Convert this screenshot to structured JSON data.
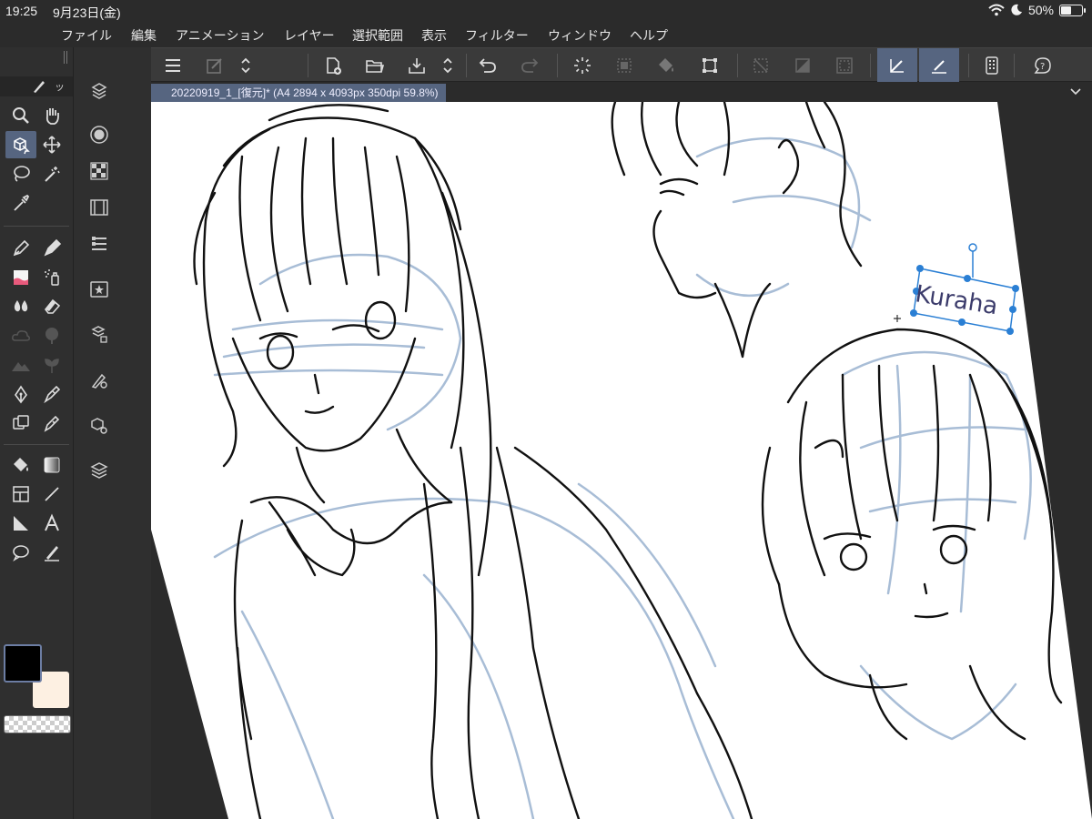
{
  "status": {
    "time": "19:25",
    "date": "9月23日(金)",
    "battery": "50%"
  },
  "menu": [
    "ファイル",
    "編集",
    "アニメーション",
    "レイヤー",
    "選択範囲",
    "表示",
    "フィルター",
    "ウィンドウ",
    "ヘルプ"
  ],
  "document": {
    "tab_title": "20220919_1_[復元]* (A4 2894 x 4093px 350dpi 59.8%)"
  },
  "canvas": {
    "text_layer": "Kuraha"
  },
  "colors": {
    "main": "#000000",
    "sub": "#fdf0e2",
    "accent": "#566580",
    "sketch_blue": "#9fb6d2"
  },
  "toolbar_icons": [
    "menu-icon",
    "quick-access-icon",
    "up-down-icon",
    "new-canvas-icon",
    "open-folder-icon",
    "save-icon",
    "undo-icon",
    "redo-icon",
    "clear-icon",
    "fill-icon",
    "transform-icon",
    "ruler-icon",
    "snap-icon",
    "help-icon"
  ]
}
